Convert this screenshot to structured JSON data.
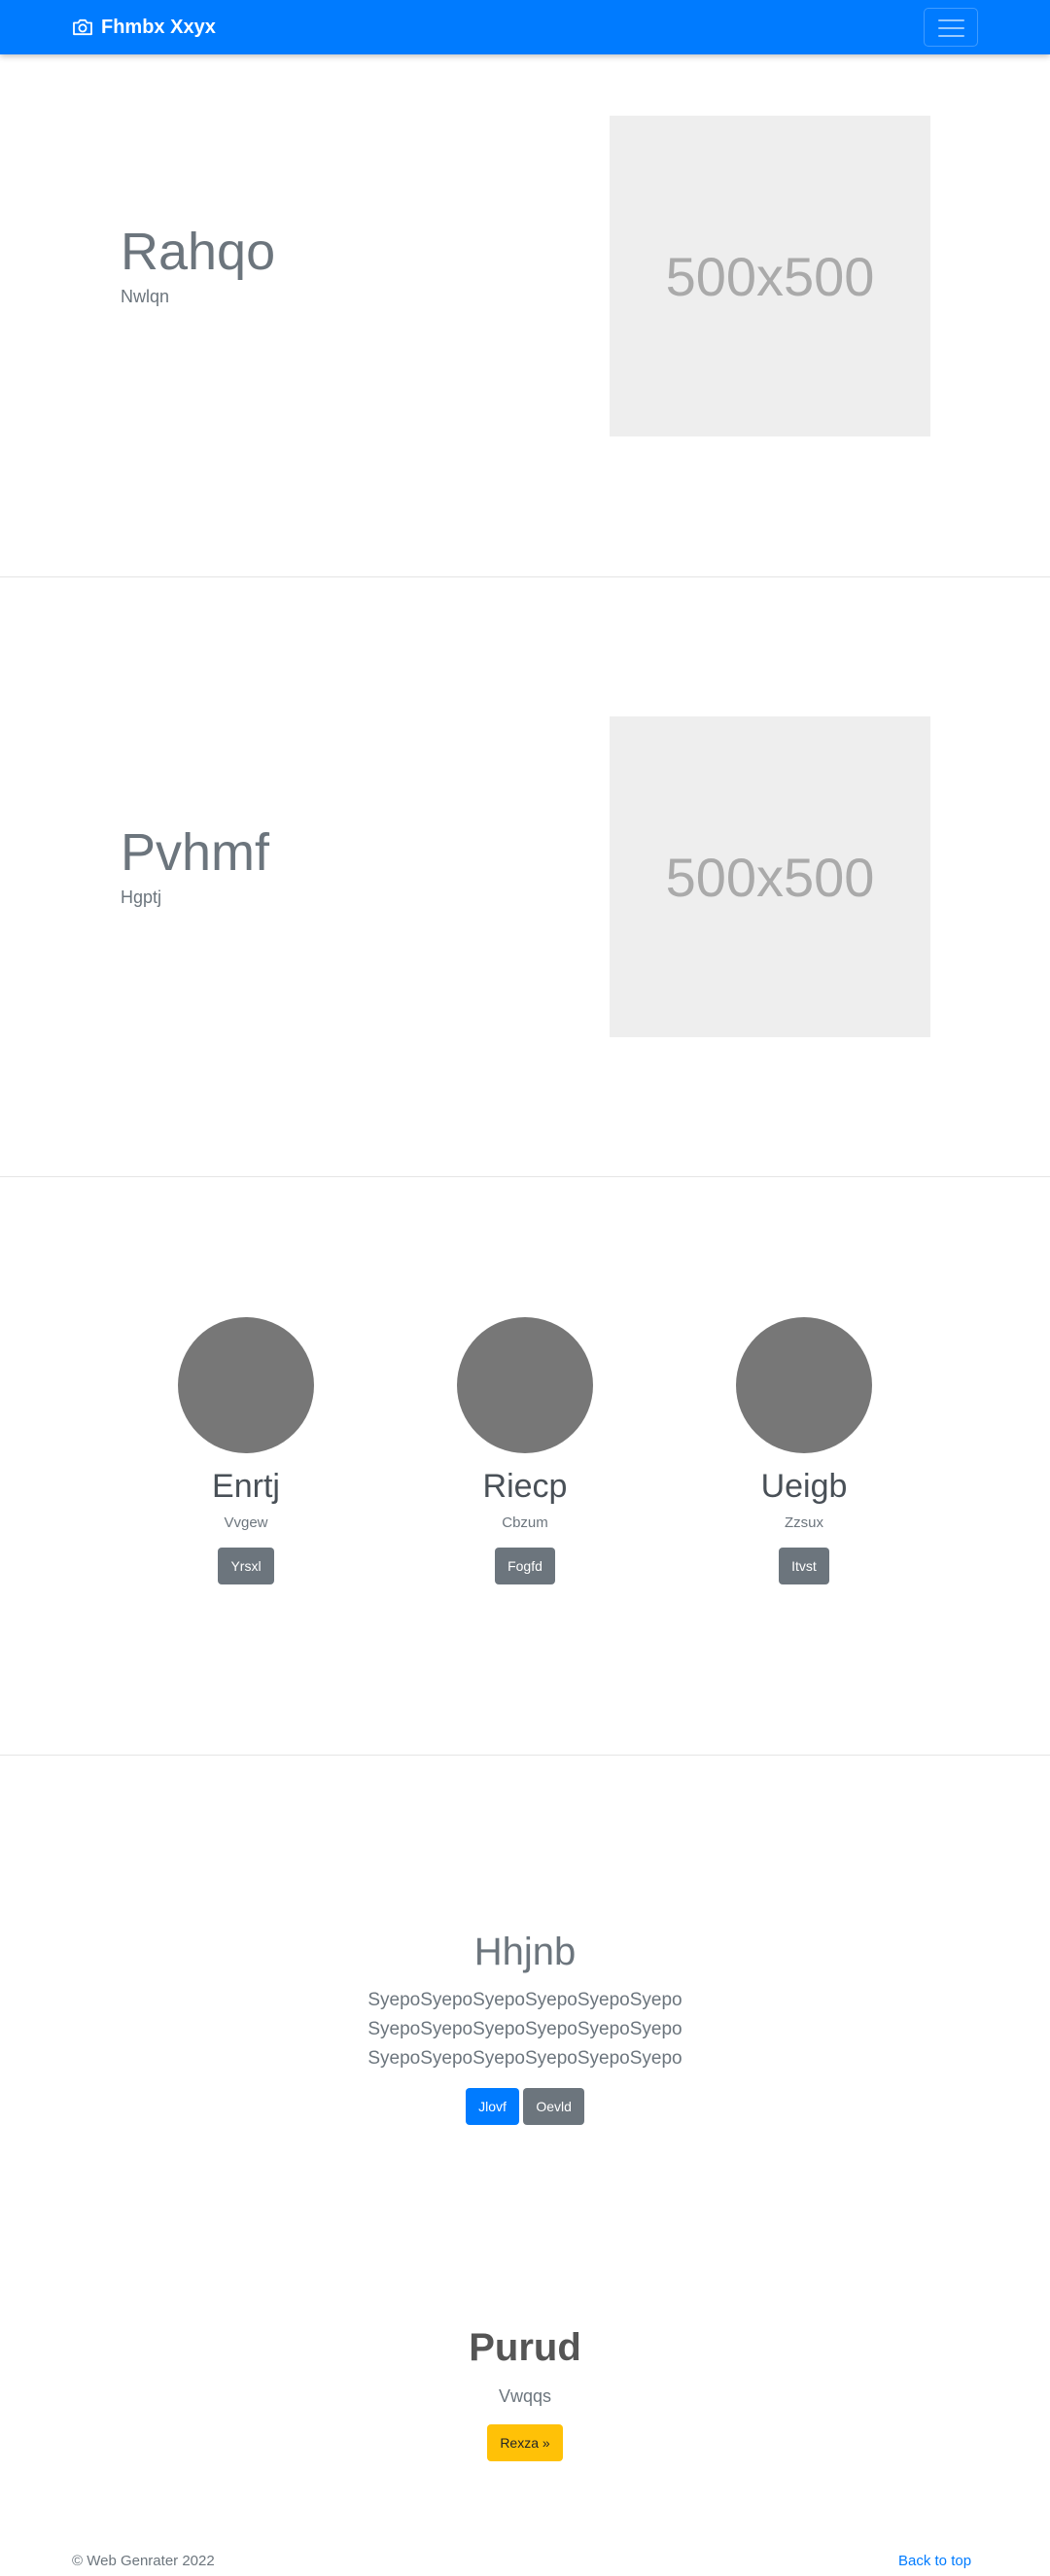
{
  "navbar": {
    "brand": "Fhmbx Xxyx"
  },
  "features": [
    {
      "title": "Rahqo",
      "subtitle": "Nwlqn",
      "image_label": "500x500"
    },
    {
      "title": "Pvhmf",
      "subtitle": "Hgptj",
      "image_label": "500x500"
    }
  ],
  "team": [
    {
      "name": "Enrtj",
      "role": "Vvgew",
      "button": "Yrsxl"
    },
    {
      "name": "Riecp",
      "role": "Cbzum",
      "button": "Fogfd"
    },
    {
      "name": "Ueigb",
      "role": "Zzsux",
      "button": "Itvst"
    }
  ],
  "jumbotron": {
    "title": "Hhjnb",
    "lines": [
      "SyepoSyepoSyepoSyepoSyepoSyepo",
      "SyepoSyepoSyepoSyepoSyepoSyepo",
      "SyepoSyepoSyepoSyepoSyepoSyepo"
    ],
    "primary_button": "Jlovf",
    "secondary_button": "Oevld"
  },
  "cta": {
    "title": "Purud",
    "subtitle": "Vwqqs",
    "button": "Rexza »"
  },
  "footer": {
    "copyright": "© Web Genrater 2022",
    "back_to_top": "Back to top"
  }
}
